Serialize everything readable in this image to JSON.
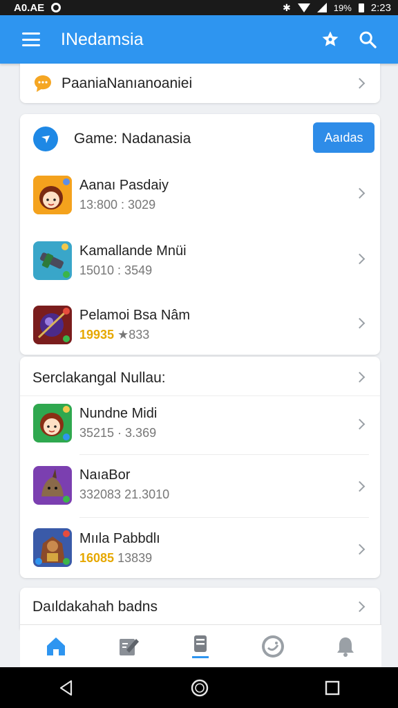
{
  "status_bar": {
    "left_text": "A0.AE",
    "battery": "19%",
    "time": "2:23"
  },
  "app_bar": {
    "title": "INedamsia"
  },
  "top_card": {
    "label": "PaaniaNanıanoaniei"
  },
  "games_card": {
    "title": "Game: Nadanasia",
    "action_label": "Aaıdas",
    "items": [
      {
        "title": "Aanaı Pasdaiy",
        "subtitle": "13:800 : 3029",
        "icon": "girl-character-icon"
      },
      {
        "title": "Kamallande Mnüi",
        "subtitle": "15010 : 3549",
        "icon": "robot-arm-icon"
      },
      {
        "title": "Pelamoi Bsa Nâm",
        "subtitle_highlight": "19935",
        "subtitle_rest": "★833",
        "icon": "purple-orb-icon"
      }
    ]
  },
  "section2": {
    "header": "Serclakangal Nullau:",
    "items": [
      {
        "title": "Nundne Midi",
        "subtitle": "35215 · 3.369",
        "icon": "girl-character-icon"
      },
      {
        "title": "NaıaBor",
        "subtitle": "332083 21.3010",
        "icon": "horned-creature-icon"
      },
      {
        "title": "Mııla Pabbdlı",
        "subtitle_highlight": "16085",
        "subtitle_rest": "13839",
        "icon": "warrior-icon"
      }
    ]
  },
  "bottom_card": {
    "label": "Daıldakahah badns"
  },
  "bottom_nav": {
    "items": [
      "home-icon",
      "edit-icon",
      "bookmark-list-icon",
      "chat-bubble-icon",
      "bell-icon"
    ]
  },
  "colors": {
    "primary": "#2e95f0",
    "highlight_gold": "#e6a800"
  }
}
